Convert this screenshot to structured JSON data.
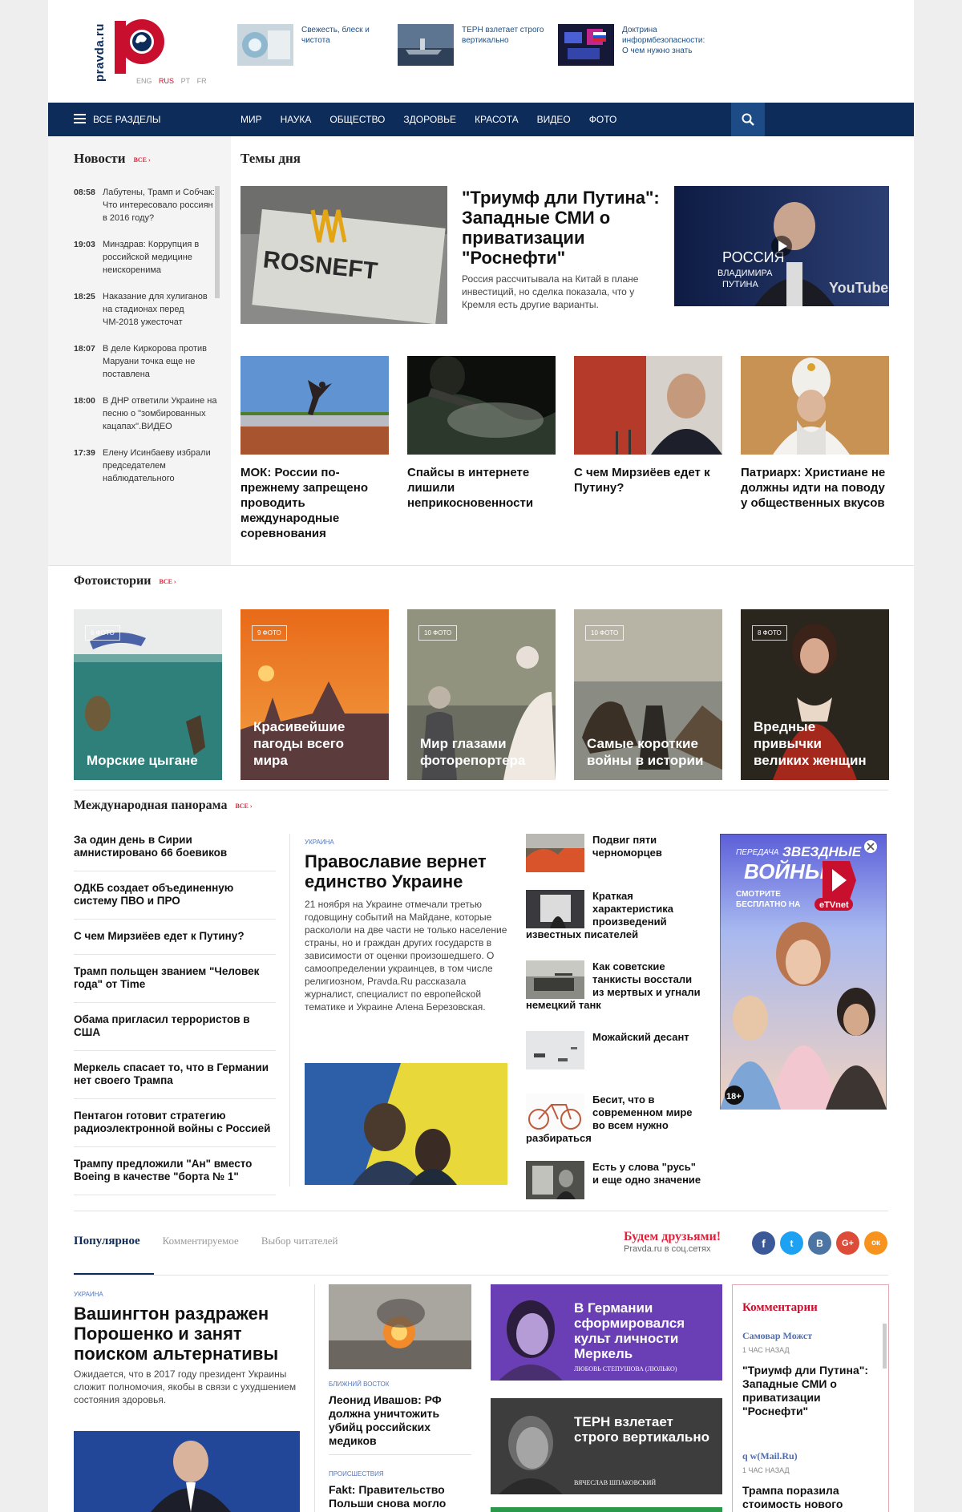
{
  "header": {
    "logo_text": "pravda.ru",
    "langs": [
      "ENG",
      "RUS",
      "PT",
      "FR"
    ],
    "teasers": [
      {
        "text": "Свежесть, блеск и чистота"
      },
      {
        "text": "ТЕРН взлетает строго вертикально"
      },
      {
        "text": "Доктрина информбезопасности: О чем нужно знать"
      }
    ]
  },
  "nav": {
    "all_sections": "ВСЕ РАЗДЕЛЫ",
    "items": [
      "МИР",
      "НАУКА",
      "ОБЩЕСТВО",
      "ЗДОРОВЬЕ",
      "КРАСОТА",
      "ВИДЕО",
      "ФОТО"
    ]
  },
  "news": {
    "title": "Новости",
    "all": "ВСЕ ›",
    "items": [
      {
        "time": "08:58",
        "text": "Лабутены, Трамп и Собчак: Что интересовало россиян в 2016 году?"
      },
      {
        "time": "19:03",
        "text": "Минздрав: Коррупция в российской медицине неискоренима"
      },
      {
        "time": "18:25",
        "text": "Наказание для хулиганов на стадионах перед ЧМ-2018 ужесточат"
      },
      {
        "time": "18:07",
        "text": "В деле Киркорова против Маруани точка еще не поставлена"
      },
      {
        "time": "18:00",
        "text": "В ДНР ответили Украине на песню о \"зомбированных кацапах\".ВИДЕО"
      },
      {
        "time": "17:39",
        "text": "Елену Исинбаеву избрали председателем наблюдательного"
      }
    ]
  },
  "themes": {
    "title": "Темы дня",
    "main_headline": "\"Триумф дли Путина\": Западные СМИ о приватизации \"Роснефти\"",
    "main_lead": "Россия рассчитывала на Китай в плане инвестиций, но сделка показала, что у Кремля есть другие варианты.",
    "main_img_text": "ROSNEFT",
    "video_text_1": "РОССИЯ",
    "video_text_2": "ВЛАДИМИРА ПУТИНА",
    "video_brand": "YouTube",
    "cards": [
      {
        "headline": "МОК: России по-прежнему запрещено проводить международные соревнования"
      },
      {
        "headline": "Спайсы в интернете лишили неприкосновенности"
      },
      {
        "headline": "С чем Мирзиёев едет к Путину?"
      },
      {
        "headline": "Патриарх: Христиане не должны идти на поводу у общественных вкусов"
      }
    ]
  },
  "photostories": {
    "title": "Фотоистории",
    "all": "ВСЕ ›",
    "items": [
      {
        "badge": "6 ФОТО",
        "caption": "Морские цыгане"
      },
      {
        "badge": "9 ФОТО",
        "caption": "Красивейшие пагоды всего мира"
      },
      {
        "badge": "10 ФОТО",
        "caption": "Мир глазами фоторепортера"
      },
      {
        "badge": "10 ФОТО",
        "caption": "Самые короткие войны в истории"
      },
      {
        "badge": "8 ФОТО",
        "caption": "Вредные привычки великих женщин"
      }
    ]
  },
  "intl": {
    "title": "Международная панорама",
    "all": "ВСЕ ›",
    "list": [
      "За один день в Сирии амнистировано 66 боевиков",
      "ОДКБ создает объединенную систему ПВО и ПРО",
      "С чем Мирзиёев едет к Путину?",
      "Трамп польщен званием \"Человек года\" от Time",
      "Обама пригласил террористов в США",
      "Меркель спасает то, что в Германии нет своего Трампа",
      "Пентагон готовит стратегию радиоэлектронной войны с Россией",
      "Трампу предложили \"Ан\" вместо Boeing в качестве \"борта № 1\""
    ],
    "mid": {
      "tag": "УКРАИНА",
      "headline": "Православие вернет единство Украине",
      "lead": "21 ноября на Украине отмечали третью годовщину событий на Майдане, которые раскололи на две части не только население страны, но и граждан других государств в зависимости от оценки произошедшего. О самоопределении украинцев, в том числе религиозном, Pravda.Ru рассказала журналист, специалист по европейской тематике и Украине Алена Березовская."
    },
    "minis": [
      "Подвиг пяти черноморцев",
      "Краткая характеристика произведений известных писателей",
      "Как советские танкисты восстали из мертвых и угнали немецкий танк",
      "Можайский десант",
      "Бесит, что в современном мире во всем нужно разбираться",
      "Есть у слова \"русь\" и еще одно значение"
    ],
    "ad": {
      "line1": "ПЕРЕДАЧА",
      "line2": "ЗВЕЗДНЫЕ",
      "line3": "ВОЙНЫ",
      "line4": "СМОТРИТЕ БЕСПЛАТНО НА",
      "channel": "eTVnet",
      "age": "18+"
    }
  },
  "popular": {
    "tabs": [
      "Популярное",
      "Комментируемое",
      "Выбор читателей"
    ],
    "friends_title": "Будем друзьями!",
    "friends_sub": "Pravda.ru в соц.сетях",
    "social": [
      "f",
      "t",
      "В",
      "G+",
      "ок"
    ],
    "main": {
      "tag": "УКРАИНА",
      "headline": "Вашингтон раздражен Порошенко и занят поиском альтернативы",
      "lead": "Ожидается, что в 2017 году президент Украины сложит полномочия, якобы в связи с ухудшением состояния здоровья."
    },
    "col2": [
      {
        "tag": "БЛИЖНИЙ ВОСТОК",
        "headline": "Леонид Ивашов: РФ должна уничтожить убийц российских медиков"
      },
      {
        "tag": "ПРОИСШЕСТВИЯ",
        "headline": "Fakt: Правительство Польши снова могло"
      }
    ],
    "opinions": [
      {
        "headline": "В Германии сформировался культ личности Меркель",
        "author": "ЛЮБОВЬ СТЕПУШОВА (ЛЮЛЬКО)"
      },
      {
        "headline": "ТЕРН взлетает строго вертикально",
        "author": "ВЯЧЕСЛАВ ШПАКОВСКИЙ"
      }
    ],
    "comments": {
      "title": "Комментарии",
      "items": [
        {
          "author": "Самовар Можст",
          "time": "1 ЧАС НАЗАД",
          "text": "\"Триумф дли Путина\": Западные СМИ о приватизации \"Роснефти\""
        },
        {
          "author": "q w(Mail.Ru)",
          "time": "1 ЧАС НАЗАД",
          "text": "Трампа поразила стоимость нового"
        }
      ]
    }
  },
  "colors": {
    "navy": "#0d2c5a",
    "accent_red": "#e2213a",
    "purple": "#6a3fb5"
  }
}
